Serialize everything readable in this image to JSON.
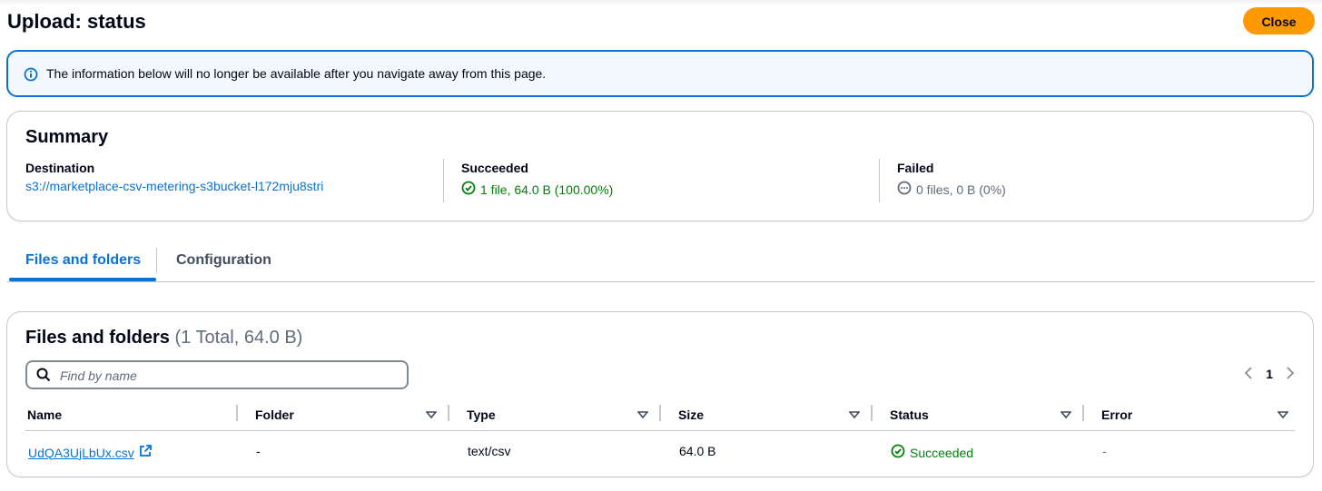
{
  "header": {
    "title": "Upload: status",
    "close_label": "Close"
  },
  "alert": {
    "icon": "info-icon",
    "text": "The information below will no longer be available after you navigate away from this page."
  },
  "summary": {
    "title": "Summary",
    "destination": {
      "label": "Destination",
      "value": "s3://marketplace-csv-metering-s3bucket-l172mju8stri"
    },
    "succeeded": {
      "label": "Succeeded",
      "value": "1 file, 64.0 B (100.00%)"
    },
    "failed": {
      "label": "Failed",
      "value": "0 files, 0 B (0%)"
    }
  },
  "tabs": {
    "files": "Files and folders",
    "configuration": "Configuration"
  },
  "files": {
    "title": "Files and folders",
    "count": "(1 Total, 64.0 B)",
    "search_placeholder": "Find by name",
    "page": "1",
    "columns": {
      "name": "Name",
      "folder": "Folder",
      "type": "Type",
      "size": "Size",
      "status": "Status",
      "error": "Error"
    },
    "rows": [
      {
        "name": "UdQA3UjLbUx.csv",
        "folder": "-",
        "type": "text/csv",
        "size": "64.0 B",
        "status": "Succeeded",
        "error": "-"
      }
    ]
  },
  "colors": {
    "accent": "#0972d3",
    "success": "#037f0c",
    "primary_button": "#ff9900"
  }
}
